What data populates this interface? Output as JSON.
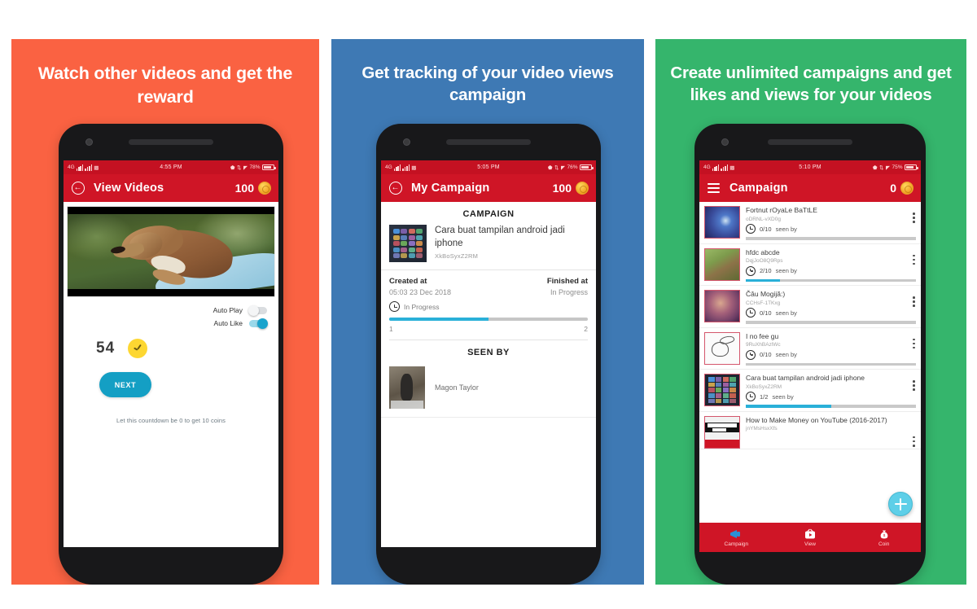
{
  "panels": [
    {
      "id": "watch-videos",
      "background_color": "#fa6242",
      "heading": "Watch other videos and get the reward",
      "phone": {
        "statusbar": {
          "network": "4G",
          "time": "4:55 PM",
          "battery": "78%"
        },
        "appbar": {
          "nav_icon": "back-arrow-icon",
          "title": "View Videos",
          "coins": "100",
          "coin_icon": "coin-icon"
        },
        "video": {
          "description": "puppy video thumbnail"
        },
        "toggles": [
          {
            "label": "Auto Play",
            "state": "off"
          },
          {
            "label": "Auto Like",
            "state": "on"
          }
        ],
        "countdown": {
          "value": "54",
          "icon": "yellow-clock-icon"
        },
        "next_button": "NEXT",
        "hint": "Let this countdown be 0 to get 10 coins"
      }
    },
    {
      "id": "my-campaign",
      "background_color": "#3e79b4",
      "heading": "Get tracking of your video views campaign",
      "phone": {
        "statusbar": {
          "network": "4G",
          "time": "5:05 PM",
          "battery": "76%"
        },
        "appbar": {
          "nav_icon": "back-arrow-icon",
          "title": "My Campaign",
          "coins": "100",
          "coin_icon": "coin-icon"
        },
        "section_title": "CAMPAIGN",
        "campaign": {
          "title": "Cara buat tampilan android jadi iphone",
          "video_id": "XkBoSyxZ2RM",
          "created_at_label": "Created at",
          "created_at_value": "05:03 23 Dec 2018",
          "finished_at_label": "Finished at",
          "finished_at_value": "In Progress",
          "status": "In Progress",
          "progress_percent": 50,
          "progress_start": "1",
          "progress_end": "2"
        },
        "seen_by_title": "SEEN BY",
        "seen_by": [
          {
            "name": "Magon Taylor"
          }
        ]
      }
    },
    {
      "id": "campaign-list",
      "background_color": "#35b56c",
      "heading": "Create unlimited campaigns and get likes and views for your videos",
      "phone": {
        "statusbar": {
          "network": "4G",
          "time": "5:10 PM",
          "battery": "75%"
        },
        "appbar": {
          "nav_icon": "hamburger-menu-icon",
          "title": "Campaign",
          "coins": "0",
          "coin_icon": "coin-icon"
        },
        "items": [
          {
            "title": "Fortnut rOyaLe BaTtLE",
            "id": "oDRNL-vXD0g",
            "count": "0/10",
            "seen_by": "seen by",
            "progress_percent": 0,
            "thumb": "game-blue"
          },
          {
            "title": "hfdc abcde",
            "id": "DqjJoO8Q9Rps",
            "count": "2/10",
            "seen_by": "seen by",
            "progress_percent": 20,
            "thumb": "dog-green"
          },
          {
            "title": "Čâu Mogijă:)",
            "id": "CCHsF-1TKxg",
            "count": "0/10",
            "seen_by": "seen by",
            "progress_percent": 0,
            "thumb": "portrait-purple"
          },
          {
            "title": "I no fee gu",
            "id": "9RuXhBAzlWc",
            "count": "0/10",
            "seen_by": "seen by",
            "progress_percent": 0,
            "thumb": "sketch-white"
          },
          {
            "title": "Cara buat tampilan android jadi iphone",
            "id": "XkBoSyxZ2RM",
            "count": "1/2",
            "seen_by": "seen by",
            "progress_percent": 50,
            "thumb": "phone-grid"
          },
          {
            "title": "How to Make Money on YouTube (2016-2017)",
            "id": "jnYMsHsxXfs",
            "count": "",
            "seen_by": "",
            "progress_percent": 0,
            "thumb": "make-money"
          }
        ],
        "fab": {
          "icon": "plus-icon"
        },
        "bottom_nav": [
          {
            "label": "Campaign",
            "icon": "megaphone-icon"
          },
          {
            "label": "View",
            "icon": "tv-icon"
          },
          {
            "label": "Coin",
            "icon": "money-bag-icon"
          }
        ]
      }
    }
  ]
}
